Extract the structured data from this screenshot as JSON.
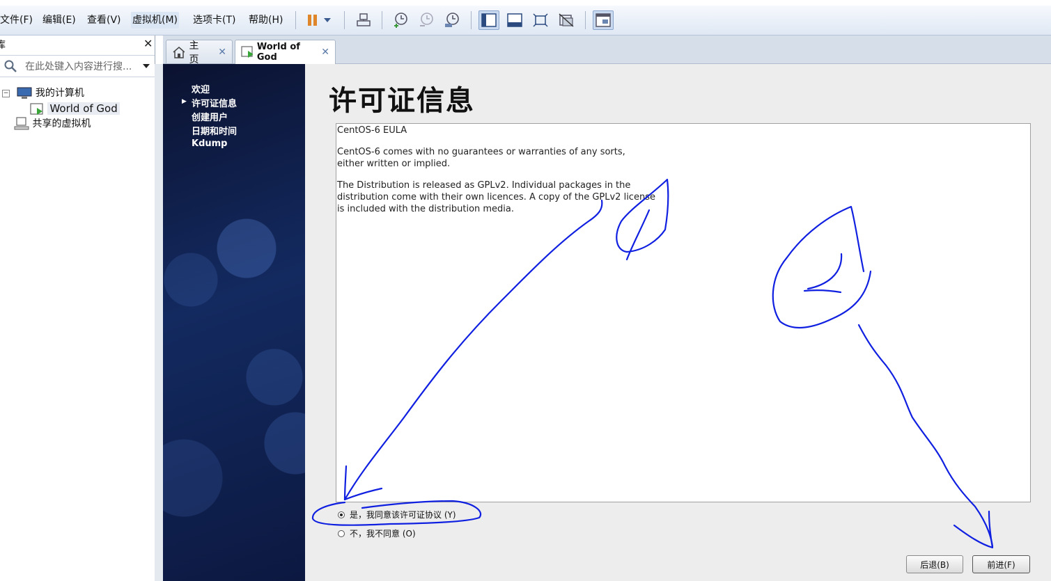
{
  "menubar": {
    "items": [
      "文件(F)",
      "编辑(E)",
      "查看(V)",
      "虚拟机(M)",
      "选项卡(T)",
      "帮助(H)"
    ]
  },
  "toolbar": {
    "icons": [
      "pause-icon",
      "dropdown-icon",
      "send-keys-icon",
      "snapshot-icon",
      "revert-snapshot-icon",
      "snapshot-manager-icon",
      "library-view-icon",
      "console-view-icon",
      "fullscreen-icon",
      "unity-icon",
      "thumbnail-icon"
    ]
  },
  "library": {
    "title": "库",
    "search_placeholder": "在此处键入内容进行搜...",
    "tree": [
      {
        "label": "我的计算机",
        "icon": "computer-icon"
      },
      {
        "label": "World of God",
        "icon": "vm-icon"
      },
      {
        "label": "共享的虚拟机",
        "icon": "shared-vm-icon"
      }
    ]
  },
  "tabs": [
    {
      "label": "主页",
      "icon": "home-icon"
    },
    {
      "label": "World of God",
      "icon": "vm-icon"
    }
  ],
  "installer": {
    "steps": [
      "欢迎",
      "许可证信息",
      "创建用户",
      "日期和时间",
      "Kdump"
    ],
    "current_step": "许可证信息",
    "title": "许可证信息",
    "eula": [
      "CentOS-6 EULA",
      "CentOS-6 comes with no guarantees or warranties of any sorts,\neither written or implied.",
      "The Distribution is released as GPLv2. Individual packages in the\ndistribution come with their own licences. A copy of the GPLv2 license\nis included with the distribution media."
    ],
    "agree_label": "是，我同意该许可证协议 (Y)",
    "disagree_label": "不，我不同意 (O)",
    "back_label": "后退(B)",
    "forward_label": "前进(F)",
    "selected": "agree"
  },
  "colors": {
    "annotation_ink": "#1020e0",
    "sidebar_dark": "#0b1230"
  }
}
